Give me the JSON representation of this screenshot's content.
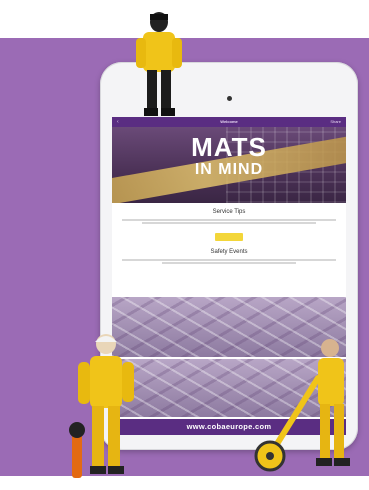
{
  "app_bar": {
    "back_icon": "chevron-left-icon",
    "title": "Welcome",
    "share_label": "Share"
  },
  "hero": {
    "title_line1": "MATS",
    "title_line2": "IN MIND",
    "tagline": ""
  },
  "section_1": {
    "title": "Service Tips",
    "text": "",
    "button_label": ""
  },
  "section_2": {
    "title": "Safety Events",
    "text": ""
  },
  "footer": {
    "url": "www.cobaeurope.com"
  },
  "colors": {
    "backdrop": "#9b6bb5",
    "brand_purple": "#5a2d82",
    "button_yellow": "#f3d63a"
  }
}
